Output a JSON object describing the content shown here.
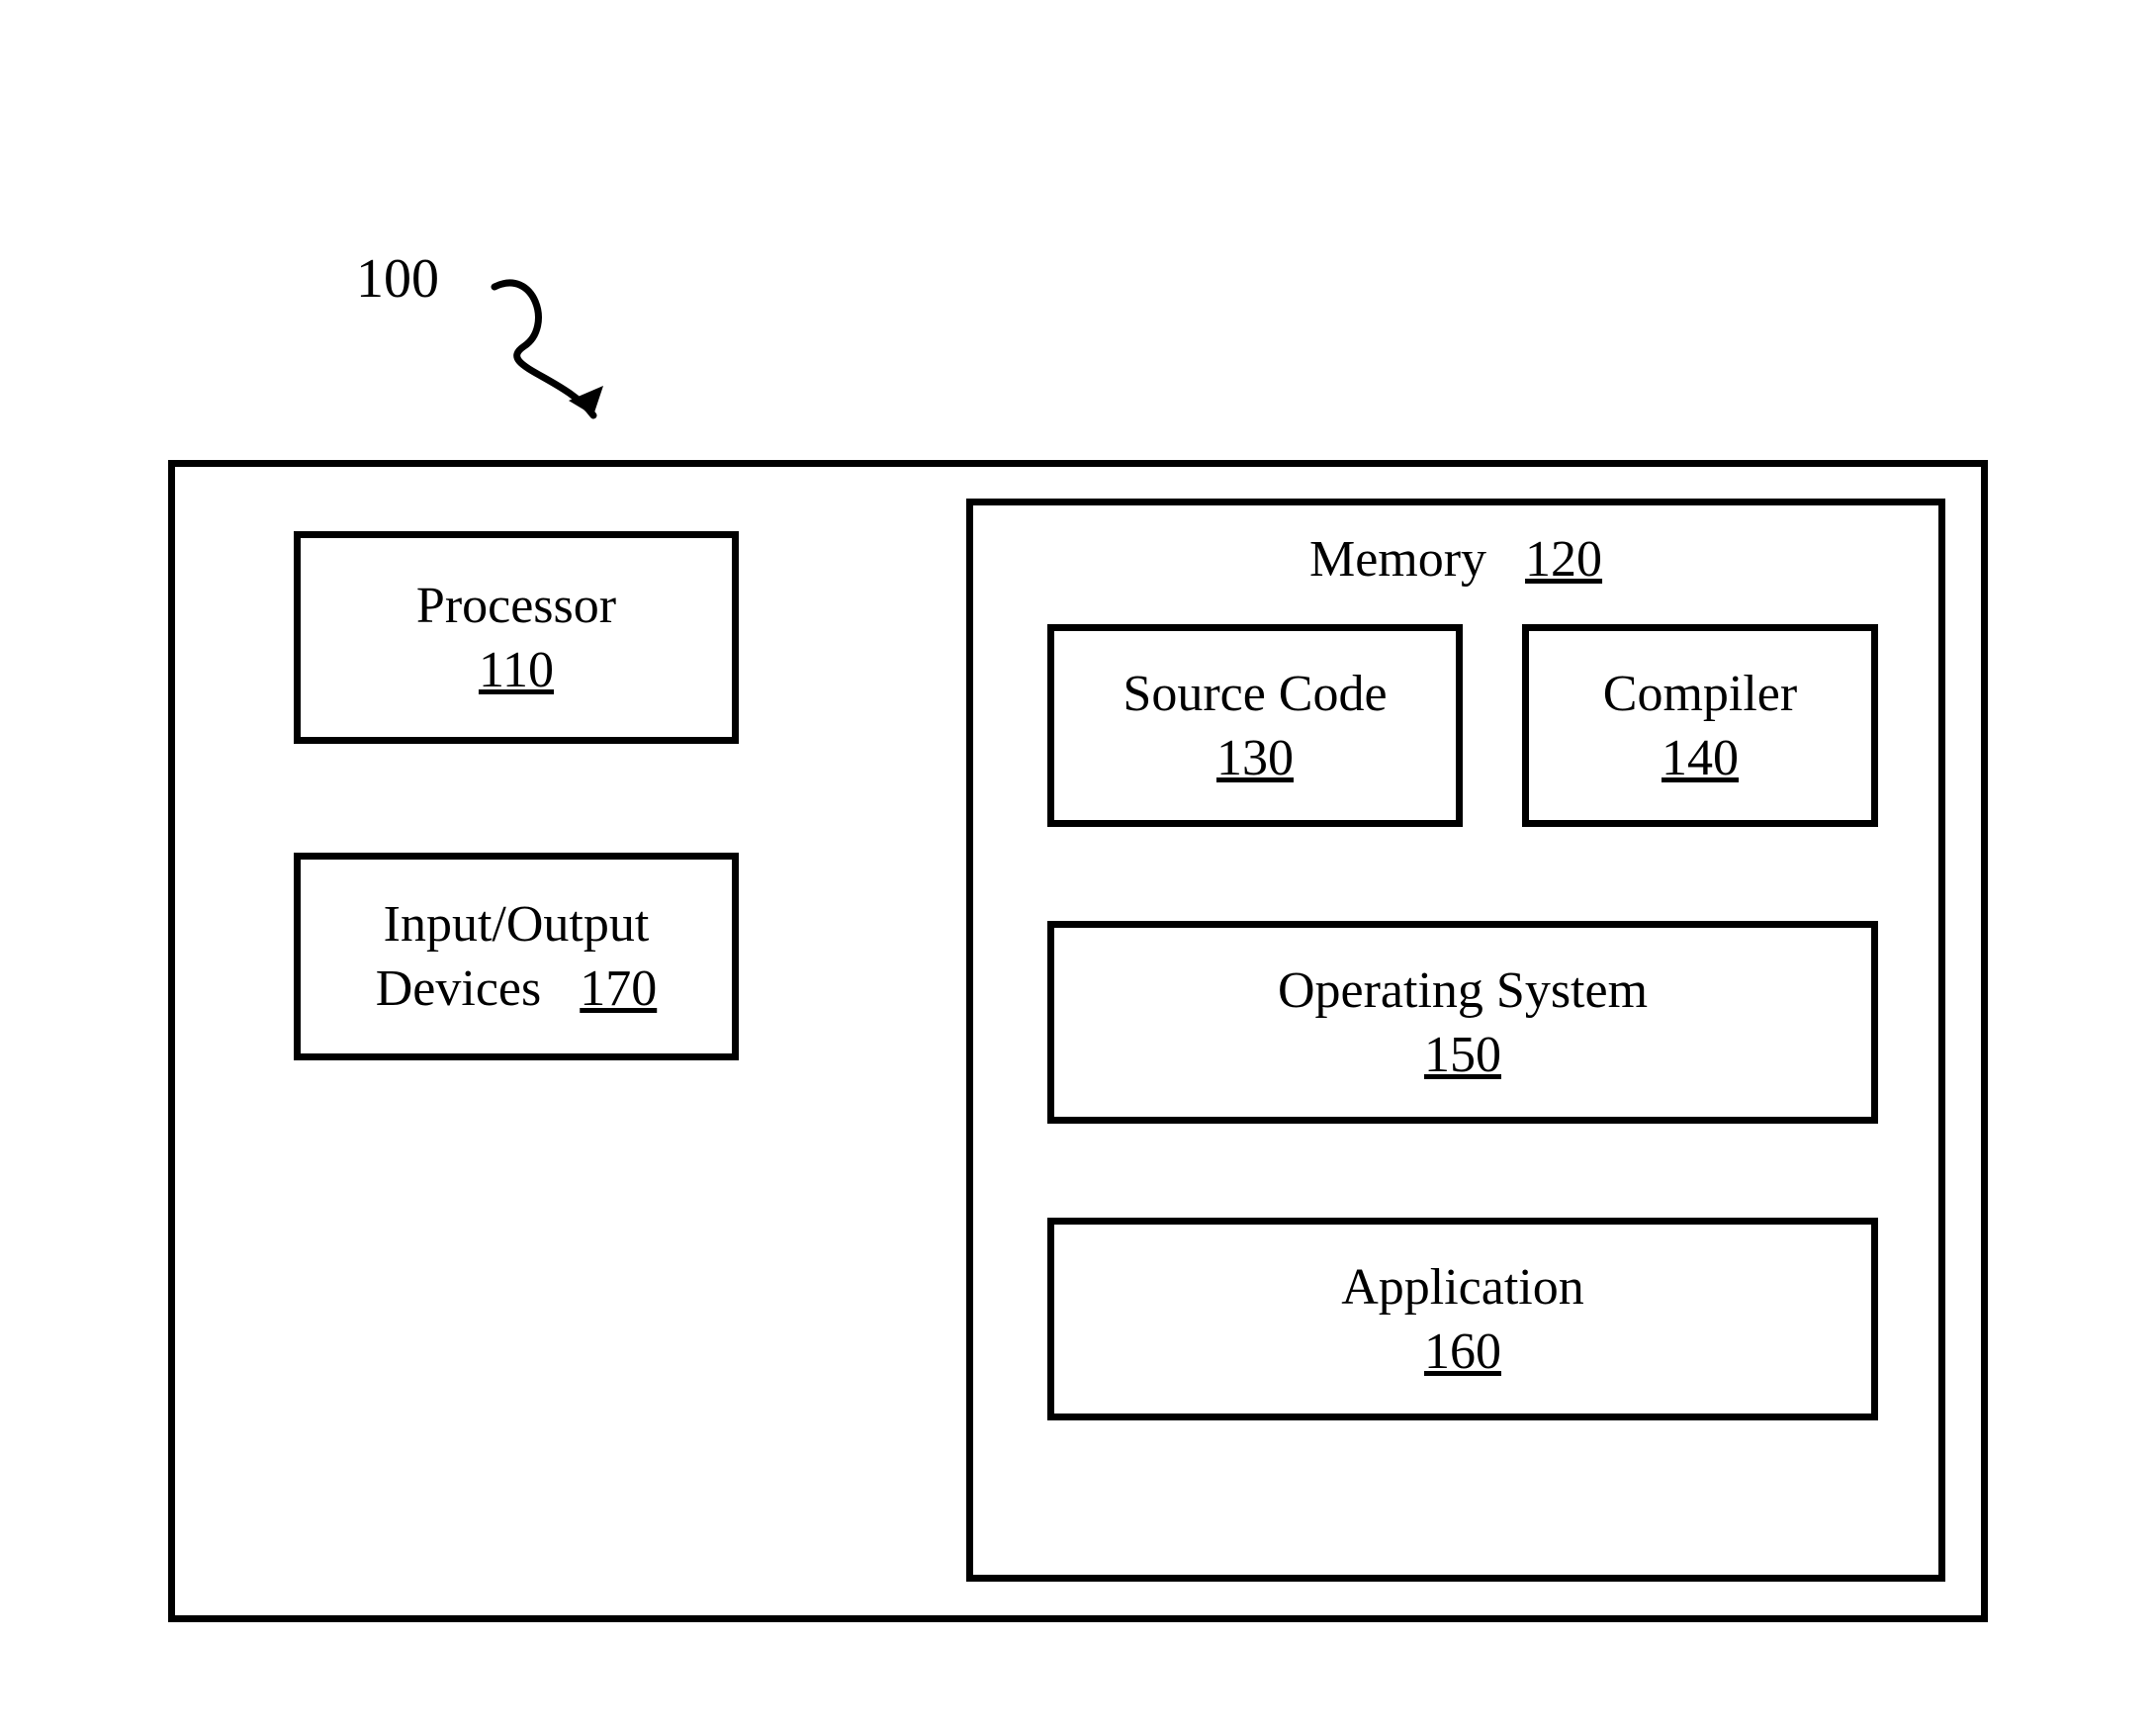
{
  "diagram": {
    "ref": "100",
    "outer": {
      "processor": {
        "label": "Processor",
        "num": "110"
      },
      "io": {
        "label_line1": "Input/Output",
        "label_line2": "Devices",
        "num": "170"
      },
      "memory": {
        "label": "Memory",
        "num": "120",
        "sourcecode": {
          "label": "Source Code",
          "num": "130"
        },
        "compiler": {
          "label": "Compiler",
          "num": "140"
        },
        "os": {
          "label": "Operating System",
          "num": "150"
        },
        "app": {
          "label": "Application",
          "num": "160"
        }
      }
    }
  }
}
